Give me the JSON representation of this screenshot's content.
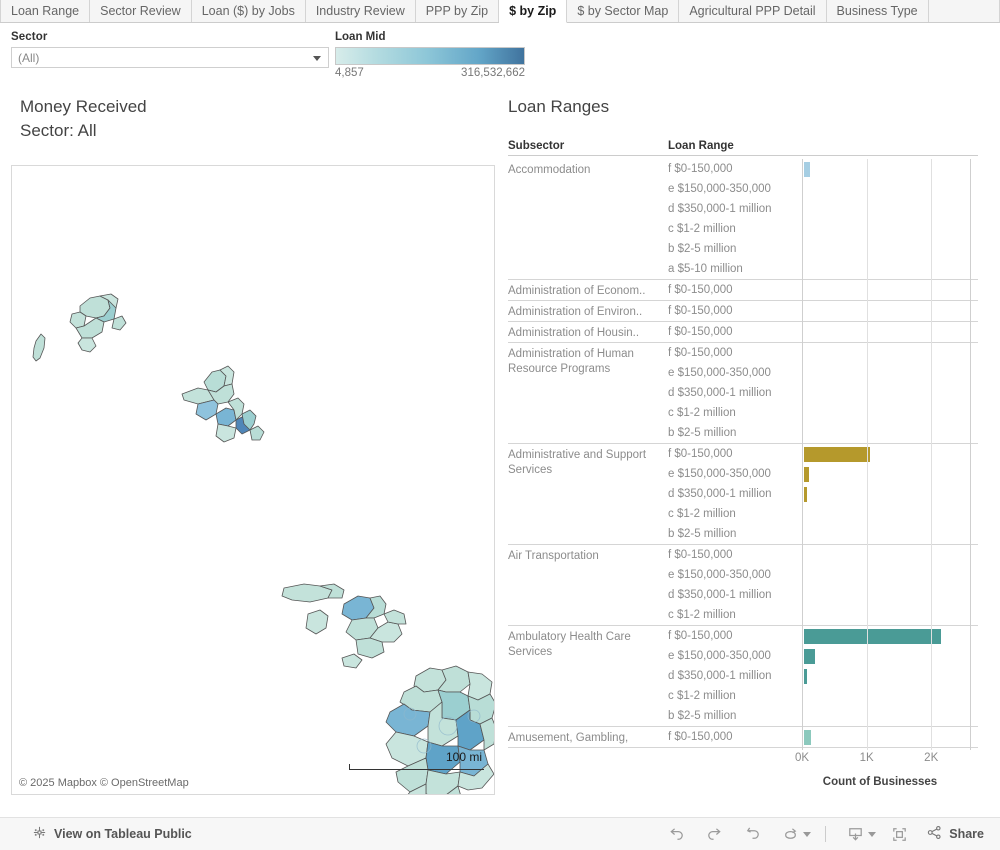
{
  "tabs": [
    {
      "label": "Loan Range",
      "active": false
    },
    {
      "label": "Sector Review",
      "active": false
    },
    {
      "label": "Loan ($) by Jobs",
      "active": false
    },
    {
      "label": "Industry Review",
      "active": false
    },
    {
      "label": "PPP by Zip",
      "active": false
    },
    {
      "label": "$ by Zip",
      "active": true
    },
    {
      "label": "$ by Sector Map",
      "active": false
    },
    {
      "label": "Agricultural PPP Detail",
      "active": false
    },
    {
      "label": "Business Type",
      "active": false
    }
  ],
  "filter": {
    "label": "Sector",
    "value": "(All)",
    "caret_icon": "chevron-down-icon"
  },
  "legend": {
    "title": "Loan Mid",
    "min": "4,857",
    "max": "316,532,662",
    "color_start": "#d7ecea",
    "color_end": "#40739e"
  },
  "map": {
    "title_line1": "Money Received",
    "title_line2": "Sector: All",
    "attribution": "© 2025 Mapbox  © OpenStreetMap",
    "scale_label": "100 mi"
  },
  "table": {
    "title": "Loan Ranges",
    "columns": [
      "Subsector",
      "Loan Range"
    ],
    "groups": [
      {
        "subsector": "Accommodation",
        "rows": [
          {
            "range": "f $0-150,000",
            "value": 90,
            "color": "#a6cee3"
          },
          {
            "range": "e $150,000-350,000",
            "value": 0,
            "color": "#a6cee3"
          },
          {
            "range": "d $350,000-1 million",
            "value": 0,
            "color": "#a6cee3"
          },
          {
            "range": "c $1-2 million",
            "value": 0,
            "color": "#a6cee3"
          },
          {
            "range": "b $2-5 million",
            "value": 0,
            "color": "#a6cee3"
          },
          {
            "range": "a $5-10 million",
            "value": 0,
            "color": "#a6cee3"
          }
        ]
      },
      {
        "subsector": "Administration of Econom..",
        "rows": [
          {
            "range": "f $0-150,000",
            "value": 0,
            "color": "#8ab0a0"
          }
        ]
      },
      {
        "subsector": "Administration of Environ..",
        "rows": [
          {
            "range": "f $0-150,000",
            "value": 0,
            "color": "#8ab0a0"
          }
        ]
      },
      {
        "subsector": "Administration of Housin..",
        "rows": [
          {
            "range": "f $0-150,000",
            "value": 0,
            "color": "#8ab0a0"
          }
        ]
      },
      {
        "subsector": "Administration of Human Resource Programs",
        "rows": [
          {
            "range": "f $0-150,000",
            "value": 0,
            "color": "#8ab0a0"
          },
          {
            "range": "e $150,000-350,000",
            "value": 0,
            "color": "#8ab0a0"
          },
          {
            "range": "d $350,000-1 million",
            "value": 0,
            "color": "#8ab0a0"
          },
          {
            "range": "c $1-2 million",
            "value": 0,
            "color": "#8ab0a0"
          },
          {
            "range": "b $2-5 million",
            "value": 0,
            "color": "#8ab0a0"
          }
        ]
      },
      {
        "subsector": "Administrative and Support Services",
        "rows": [
          {
            "range": "f $0-150,000",
            "value": 1020,
            "color": "#b5992c"
          },
          {
            "range": "e $150,000-350,000",
            "value": 75,
            "color": "#b5992c"
          },
          {
            "range": "d $350,000-1 million",
            "value": 42,
            "color": "#b5992c"
          },
          {
            "range": "c $1-2 million",
            "value": 0,
            "color": "#b5992c"
          },
          {
            "range": "b $2-5 million",
            "value": 0,
            "color": "#b5992c"
          }
        ]
      },
      {
        "subsector": "Air Transportation",
        "rows": [
          {
            "range": "f $0-150,000",
            "value": 0,
            "color": "#4a9b96"
          },
          {
            "range": "e $150,000-350,000",
            "value": 0,
            "color": "#4a9b96"
          },
          {
            "range": "d $350,000-1 million",
            "value": 0,
            "color": "#4a9b96"
          },
          {
            "range": "c $1-2 million",
            "value": 0,
            "color": "#4a9b96"
          }
        ]
      },
      {
        "subsector": "Ambulatory Health Care Services",
        "rows": [
          {
            "range": "f $0-150,000",
            "value": 2120,
            "color": "#4a9b96"
          },
          {
            "range": "e $150,000-350,000",
            "value": 170,
            "color": "#4a9b96"
          },
          {
            "range": "d $350,000-1 million",
            "value": 45,
            "color": "#4a9b96"
          },
          {
            "range": "c $1-2 million",
            "value": 0,
            "color": "#4a9b96"
          },
          {
            "range": "b $2-5 million",
            "value": 0,
            "color": "#4a9b96"
          }
        ]
      },
      {
        "subsector": "Amusement, Gambling,",
        "rows": [
          {
            "range": "f $0-150,000",
            "value": 108,
            "color": "#8cc9bd"
          }
        ]
      }
    ],
    "axis": {
      "caption": "Count of Businesses",
      "ticks": [
        "0K",
        "1K",
        "2K"
      ],
      "tick_values": [
        0,
        1000,
        2000
      ],
      "max": 2600
    }
  },
  "chart_data": {
    "type": "bar",
    "title": "Loan Ranges",
    "xlabel": "Count of Businesses",
    "ylabel": "Subsector / Loan Range",
    "xlim": [
      0,
      2600
    ],
    "xticks": [
      0,
      1000,
      2000
    ],
    "xticklabels": [
      "0K",
      "1K",
      "2K"
    ],
    "grid": true,
    "legend": "none",
    "orientation": "horizontal",
    "categories": [
      "Accommodation | f $0-150,000",
      "Accommodation | e $150,000-350,000",
      "Accommodation | d $350,000-1 million",
      "Accommodation | c $1-2 million",
      "Accommodation | b $2-5 million",
      "Accommodation | a $5-10 million",
      "Administration of Econom.. | f $0-150,000",
      "Administration of Environ.. | f $0-150,000",
      "Administration of Housin.. | f $0-150,000",
      "Administration of Human Resource Programs | f $0-150,000",
      "Administration of Human Resource Programs | e $150,000-350,000",
      "Administration of Human Resource Programs | d $350,000-1 million",
      "Administration of Human Resource Programs | c $1-2 million",
      "Administration of Human Resource Programs | b $2-5 million",
      "Administrative and Support Services | f $0-150,000",
      "Administrative and Support Services | e $150,000-350,000",
      "Administrative and Support Services | d $350,000-1 million",
      "Administrative and Support Services | c $1-2 million",
      "Administrative and Support Services | b $2-5 million",
      "Air Transportation | f $0-150,000",
      "Air Transportation | e $150,000-350,000",
      "Air Transportation | d $350,000-1 million",
      "Air Transportation | c $1-2 million",
      "Ambulatory Health Care Services | f $0-150,000",
      "Ambulatory Health Care Services | e $150,000-350,000",
      "Ambulatory Health Care Services | d $350,000-1 million",
      "Ambulatory Health Care Services | c $1-2 million",
      "Ambulatory Health Care Services | b $2-5 million",
      "Amusement, Gambling, | f $0-150,000"
    ],
    "values": [
      90,
      0,
      0,
      0,
      0,
      0,
      0,
      0,
      0,
      0,
      0,
      0,
      0,
      0,
      1020,
      75,
      42,
      0,
      0,
      0,
      0,
      0,
      0,
      2120,
      170,
      45,
      0,
      0,
      108
    ],
    "colors": [
      "#a6cee3",
      "#a6cee3",
      "#a6cee3",
      "#a6cee3",
      "#a6cee3",
      "#a6cee3",
      "#8ab0a0",
      "#8ab0a0",
      "#8ab0a0",
      "#8ab0a0",
      "#8ab0a0",
      "#8ab0a0",
      "#8ab0a0",
      "#8ab0a0",
      "#b5992c",
      "#b5992c",
      "#b5992c",
      "#b5992c",
      "#b5992c",
      "#4a9b96",
      "#4a9b96",
      "#4a9b96",
      "#4a9b96",
      "#4a9b96",
      "#4a9b96",
      "#4a9b96",
      "#4a9b96",
      "#4a9b96",
      "#8cc9bd"
    ]
  },
  "bottombar": {
    "tableau_link": "View on Tableau Public",
    "share_label": "Share",
    "icons": [
      "undo-icon",
      "redo-icon",
      "revert-icon",
      "refresh-icon",
      "download-icon",
      "fullscreen-icon",
      "share-icon"
    ]
  }
}
